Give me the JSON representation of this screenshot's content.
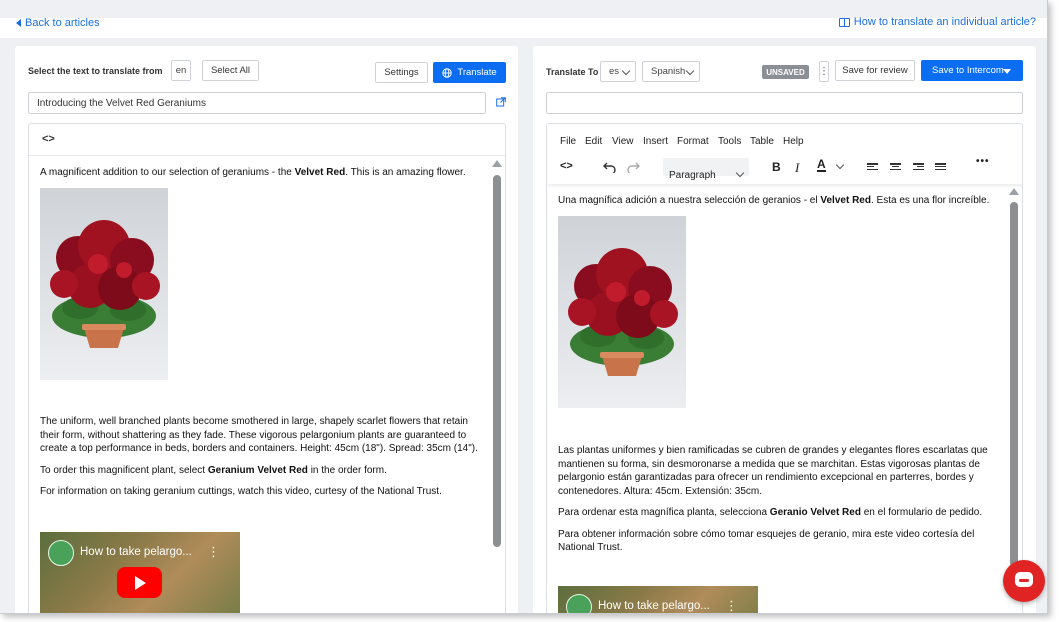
{
  "header": {
    "back_label": "Back to articles",
    "help_label": "How to translate an individual article?"
  },
  "source": {
    "select_label": "Select the text to translate from",
    "lang_code": "en",
    "select_all": "Select All",
    "settings": "Settings",
    "translate": "Translate",
    "title_value": "Introducing the Velvet Red Geraniums",
    "code_toggle": "<>",
    "p1_pre": "A magnificent addition to our selection of geraniums - the ",
    "p1_bold": "Velvet Red",
    "p1_post": ". This is an amazing flower.",
    "p2": "The uniform, well branched plants become smothered in large, shapely scarlet flowers that retain their form, without shattering as they fade. These vigorous pelargonium plants are guaranteed to create a top performance in beds, borders and containers. Height: 45cm (18\"). Spread: 35cm (14\").",
    "p3_pre": "To order this magnificent plant, select ",
    "p3_bold": "Geranium Velvet Red",
    "p3_post": " in the order form.",
    "p4": "For information on taking geranium cuttings, watch this video, curtesy of the National Trust.",
    "video_title": "How to take pelargo..."
  },
  "target": {
    "translate_to_label": "Translate To",
    "lang_code": "es",
    "lang_name": "Spanish",
    "status_badge": "UNSAVED",
    "save_review": "Save for review",
    "save_intercom": "Save to Intercom",
    "title_value": "",
    "menu": [
      "File",
      "Edit",
      "View",
      "Insert",
      "Format",
      "Tools",
      "Table",
      "Help"
    ],
    "paragraph_select": "Paragraph",
    "p1_pre": "Una magnífica adición a nuestra selección de geranios - el ",
    "p1_bold": "Velvet Red",
    "p1_post": ". Esta es una flor increíble.",
    "p2": "Las plantas uniformes y bien ramificadas se cubren de grandes y elegantes flores escarlatas que mantienen su forma, sin desmoronarse a medida que se marchitan. Estas vigorosas plantas de pelargonio están garantizadas para ofrecer un rendimiento excepcional en parterres, bordes y contenedores. Altura: 45cm. Extensión: 35cm.",
    "p3_pre": "Para ordenar esta magnífica planta, selecciona ",
    "p3_bold": "Geranio Velvet Red",
    "p3_post": " en el formulario de pedido.",
    "p4": "Para obtener información sobre cómo tomar esquejes de geranio, mira este video cortesía del National Trust.",
    "video_title": "How to take pelargo..."
  },
  "colors": {
    "accent": "#0b6ef2",
    "link": "#1a6fe0",
    "badge": "#8a8f96",
    "chat": "#e02424"
  }
}
